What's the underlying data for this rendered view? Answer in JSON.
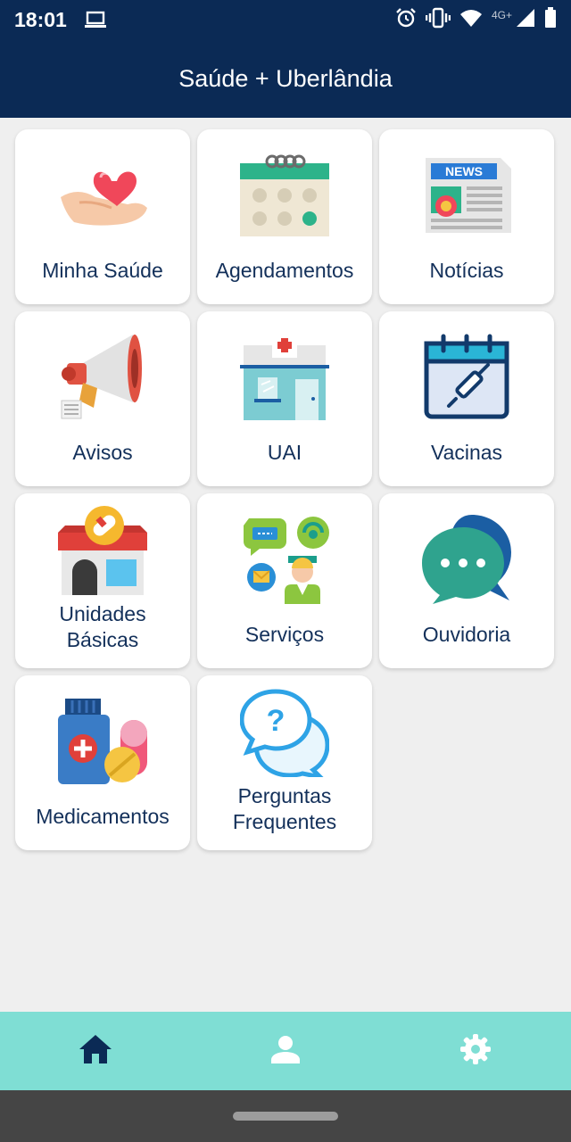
{
  "status_bar": {
    "time": "18:01",
    "network": "4G+",
    "icons": [
      "laptop-icon",
      "alarm-icon",
      "vibrate-icon",
      "wifi-icon",
      "signal-icon",
      "battery-icon"
    ]
  },
  "app_bar": {
    "title": "Saúde + Uberlândia",
    "background": "#0b2a55"
  },
  "tiles": [
    {
      "label": "Minha Saúde",
      "icon": "heart-hand-icon"
    },
    {
      "label": "Agendamentos",
      "icon": "calendar-icon"
    },
    {
      "label": "Notícias",
      "icon": "newspaper-icon"
    },
    {
      "label": "Avisos",
      "icon": "megaphone-icon"
    },
    {
      "label": "UAI",
      "icon": "clinic-building-icon"
    },
    {
      "label": "Vacinas",
      "icon": "vaccine-calendar-icon"
    },
    {
      "label_line1": "Unidades",
      "label_line2": "Básicas",
      "icon": "health-unit-icon"
    },
    {
      "label": "Serviços",
      "icon": "support-services-icon"
    },
    {
      "label": "Ouvidoria",
      "icon": "chat-bubbles-icon"
    },
    {
      "label": "Medicamentos",
      "icon": "medicine-bottle-icon"
    },
    {
      "label_line1": "Perguntas",
      "label_line2": "Frequentes",
      "icon": "question-bubbles-icon"
    }
  ],
  "bottom_nav": {
    "items": [
      {
        "name": "home",
        "icon": "home-icon",
        "active": true
      },
      {
        "name": "profile",
        "icon": "user-icon",
        "active": false
      },
      {
        "name": "settings",
        "icon": "gear-icon",
        "active": false
      }
    ],
    "background": "#7fded4",
    "active_color": "#0b2a55",
    "inactive_color": "#ffffff"
  }
}
